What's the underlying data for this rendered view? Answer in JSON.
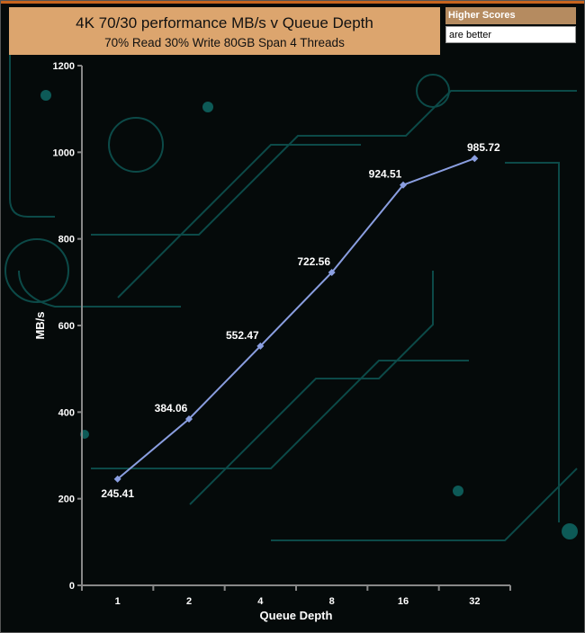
{
  "badge": {
    "line1": "Higher Scores",
    "line2": "are better"
  },
  "chart_data": {
    "type": "line",
    "title": "4K 70/30 performance MB/s v Queue Depth",
    "subtitle": "70% Read 30% Write 80GB Span 4 Threads",
    "xlabel": "Queue Depth",
    "ylabel": "MB/s",
    "categories": [
      "1",
      "2",
      "4",
      "8",
      "16",
      "32"
    ],
    "values": [
      245.41,
      384.06,
      552.47,
      722.56,
      924.51,
      985.72
    ],
    "labels": [
      "245.41",
      "384.06",
      "552.47",
      "722.56",
      "924.51",
      "985.72"
    ],
    "ylim": [
      0,
      1200
    ],
    "yticks": [
      "0",
      "200",
      "400",
      "600",
      "800",
      "1000",
      "1200"
    ],
    "line_color": "#8a9ee0",
    "grid": false
  }
}
